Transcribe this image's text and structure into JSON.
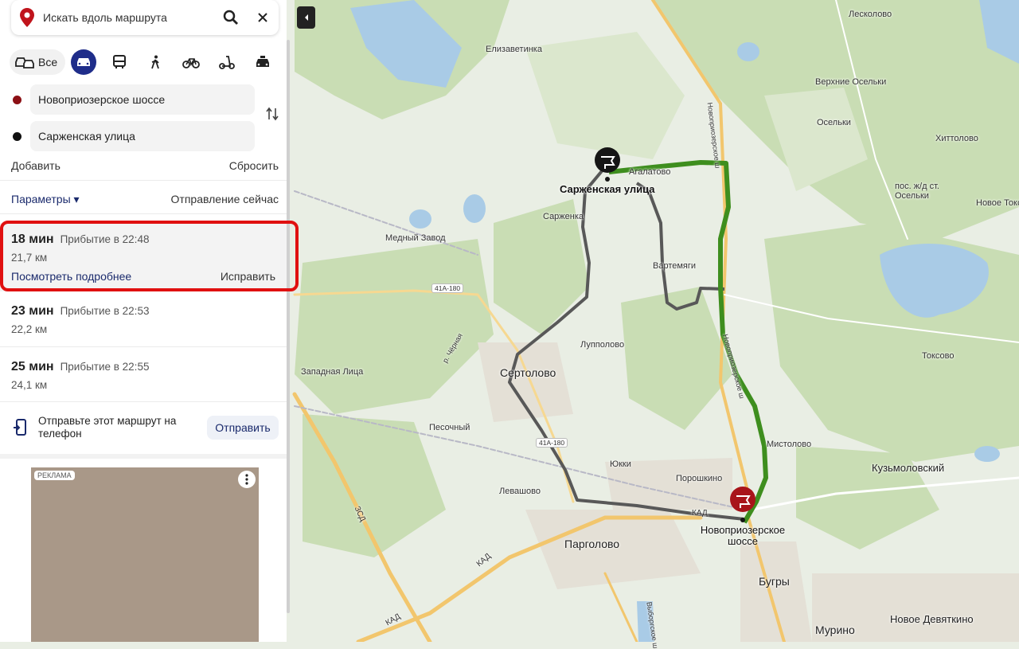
{
  "search": {
    "placeholder": "Искать вдоль маршрута"
  },
  "modes": {
    "all_label": "Все"
  },
  "route_points": {
    "from": "Новоприозерское шоссе",
    "to": "Сарженская улица"
  },
  "actions": {
    "add": "Добавить",
    "reset": "Сбросить"
  },
  "params": {
    "label": "Параметры ▾",
    "departure": "Отправление сейчас"
  },
  "routes": [
    {
      "time": "18 мин",
      "arrival": "Прибытие в 22:48",
      "distance": "21,7 км",
      "details": "Посмотреть подробнее",
      "fix": "Исправить"
    },
    {
      "time": "23 мин",
      "arrival": "Прибытие в 22:53",
      "distance": "22,2 км"
    },
    {
      "time": "25 мин",
      "arrival": "Прибытие в 22:55",
      "distance": "24,1 км"
    }
  ],
  "send": {
    "text": "Отправьте этот маршрут на телефон",
    "button": "Отправить"
  },
  "ad": {
    "label": "РЕКЛАМА"
  },
  "map": {
    "places": [
      "Лесколово",
      "Елизаветинка",
      "Верхние Осельки",
      "Осельки",
      "Хиттолово",
      "пос. ж/д ст. Осельки",
      "Новое Токс",
      "Агалатово",
      "Сарженка",
      "Медный Завод",
      "Вартемяги",
      "Лупполово",
      "Токсово",
      "Западная Лица",
      "Сертолово",
      "Мистолово",
      "Песочный",
      "Юкки",
      "Кузьмоловский",
      "Порошкино",
      "Левашово",
      "Парголово",
      "Бугры",
      "Мурино",
      "Новое Девяткино"
    ],
    "roads": [
      "Новоприозерское ш",
      "41А-180",
      "41А-180",
      "КАД",
      "КАД",
      "КАД",
      "ЗСД",
      "Выборгское ш",
      "р. Чёрная"
    ],
    "route_end_label": "Сарженская улица",
    "route_start_label": "Новоприозерское шоссе"
  },
  "colors": {
    "primary_route": "#3e8e1e",
    "alt_route": "#585858",
    "accent": "#1f2d8a",
    "highlight": "#e01010"
  }
}
